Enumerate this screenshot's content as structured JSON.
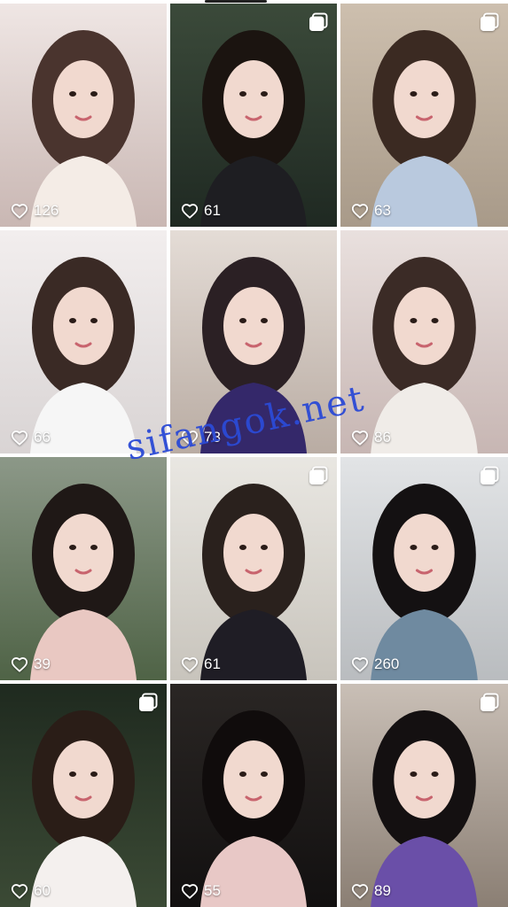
{
  "watermark": "sifangok.net",
  "posts": [
    {
      "likes": "126",
      "multi": false,
      "bg": [
        "#efe6e4",
        "#c9b7b3"
      ],
      "hair": "#4a342e",
      "cloth": "#f4ece6"
    },
    {
      "likes": "61",
      "multi": true,
      "bg": [
        "#3b4a3a",
        "#1f2922"
      ],
      "hair": "#1b1410",
      "cloth": "#1e1e22"
    },
    {
      "likes": "63",
      "multi": true,
      "bg": [
        "#cdbfae",
        "#a89a89"
      ],
      "hair": "#3b2a22",
      "cloth": "#b9c9de"
    },
    {
      "likes": "66",
      "multi": false,
      "bg": [
        "#f2eeee",
        "#d9d4d4"
      ],
      "hair": "#3a2a25",
      "cloth": "#f6f6f6"
    },
    {
      "likes": "78",
      "multi": false,
      "bg": [
        "#e4dcd6",
        "#b9aca3"
      ],
      "hair": "#2b2024",
      "cloth": "#34286a"
    },
    {
      "likes": "86",
      "multi": false,
      "bg": [
        "#e9e0de",
        "#c7b6b3"
      ],
      "hair": "#3b2b26",
      "cloth": "#f0ece8"
    },
    {
      "likes": "39",
      "multi": false,
      "bg": [
        "#8c9888",
        "#4f6346"
      ],
      "hair": "#1f1816",
      "cloth": "#e9c8c2"
    },
    {
      "likes": "61",
      "multi": true,
      "bg": [
        "#e9e7e2",
        "#c8c4bc"
      ],
      "hair": "#2a211d",
      "cloth": "#1f1d25"
    },
    {
      "likes": "260",
      "multi": true,
      "bg": [
        "#e2e4e6",
        "#b9bcbf"
      ],
      "hair": "#141112",
      "cloth": "#6f8aa0"
    },
    {
      "likes": "60",
      "multi": true,
      "bg": [
        "#1f2a1f",
        "#3b4a35"
      ],
      "hair": "#2a1d17",
      "cloth": "#f4f0ee"
    },
    {
      "likes": "55",
      "multi": false,
      "bg": [
        "#2a2624",
        "#121010"
      ],
      "hair": "#100c0c",
      "cloth": "#e8c8c6"
    },
    {
      "likes": "89",
      "multi": true,
      "bg": [
        "#c9bfb6",
        "#8b7f74"
      ],
      "hair": "#141011",
      "cloth": "#6a4fa8"
    }
  ]
}
